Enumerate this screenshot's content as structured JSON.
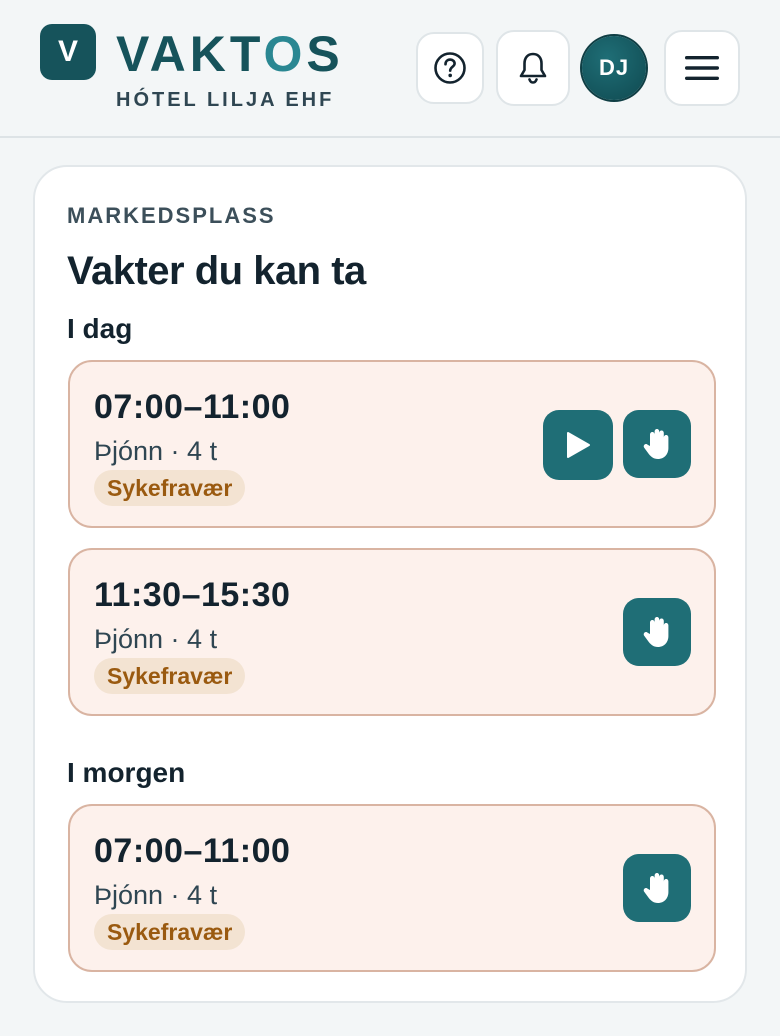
{
  "header": {
    "logo_letter": "V",
    "brand_prefix": "VAKT",
    "brand_o": "O",
    "brand_suffix": "S",
    "organization": "HÓTEL LILJA EHF",
    "user_initials": "DJ",
    "icons": [
      "help-icon",
      "bell-icon",
      "menu-icon"
    ]
  },
  "marketplace": {
    "kicker": "MARKEDSPLASS",
    "title": "Vakter du kan ta",
    "groups": [
      {
        "label": "I dag",
        "shifts": [
          {
            "time": "07:00–11:00",
            "role": "Þjónn · 4 t",
            "tag": "Sykefravær",
            "actions": [
              "play-icon",
              "hand-icon"
            ]
          },
          {
            "time": "11:30–15:30",
            "role": "Þjónn · 4 t",
            "tag": "Sykefravær",
            "actions": [
              "hand-icon"
            ]
          }
        ]
      },
      {
        "label": "I morgen",
        "shifts": [
          {
            "time": "07:00–11:00",
            "role": "Þjónn · 4 t",
            "tag": "Sykefravær",
            "actions": [
              "hand-icon"
            ]
          }
        ]
      }
    ]
  },
  "colors": {
    "primary": "#1f6e76",
    "brand": "#16535b",
    "shift_bg": "#fdf1ec",
    "shift_border": "#d9b4a2",
    "tag_bg": "#f3e3d2",
    "tag_text": "#9a5a10"
  }
}
